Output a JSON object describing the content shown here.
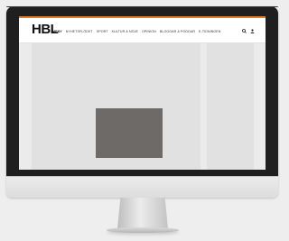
{
  "site": {
    "logo": "HBL",
    "nav": [
      {
        "label": "Meny",
        "active": true
      },
      {
        "label": "Nyhetsflödet",
        "active": false
      },
      {
        "label": "Sport",
        "active": false
      },
      {
        "label": "Kultur & Nöje",
        "active": false
      },
      {
        "label": "Opinion",
        "active": false
      },
      {
        "label": "Bloggar & Poddar",
        "active": false
      },
      {
        "label": "E-tidningen",
        "active": false
      }
    ],
    "icons": {
      "search": "search-icon",
      "user": "user-icon"
    }
  },
  "colors": {
    "accent": "#e27d2a",
    "bezel": "#1f1f1f",
    "image_placeholder": "#6e6a67",
    "content_bg": "#e1e1e1"
  }
}
